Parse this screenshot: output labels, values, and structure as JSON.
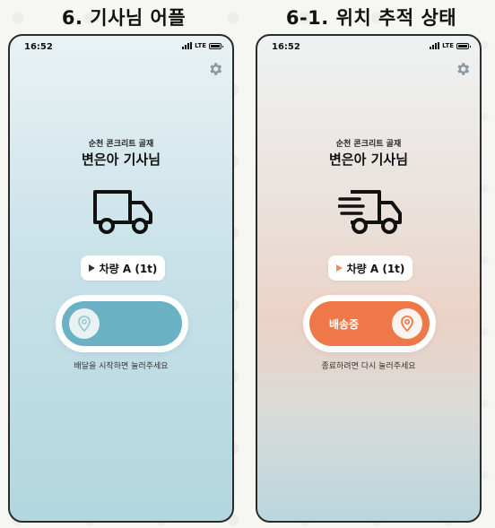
{
  "left_screen": {
    "heading": "6. 기사님 어플",
    "status_time": "16:52",
    "network": "LTE",
    "company": "순천 콘크리트 골재",
    "driver_name": "변은아 기사님",
    "vehicle": "차량 A (1t)",
    "hint": "배달을 시작하면 눌러주세요",
    "slider_label": "",
    "state": "idle",
    "accent": "#6bb1c4"
  },
  "right_screen": {
    "heading": "6-1. 위치 추적 상태",
    "status_time": "16:52",
    "network": "LTE",
    "company": "순천 콘크리트 골재",
    "driver_name": "변은아 기사님",
    "vehicle": "차량 A (1t)",
    "hint": "종료하려면 다시 눌러주세요",
    "slider_label": "배송중",
    "state": "delivering",
    "accent": "#ee7848"
  },
  "icons": [
    "gear-icon",
    "truck-icon",
    "moving-truck-icon",
    "location-pin-icon",
    "play-triangle-icon"
  ]
}
